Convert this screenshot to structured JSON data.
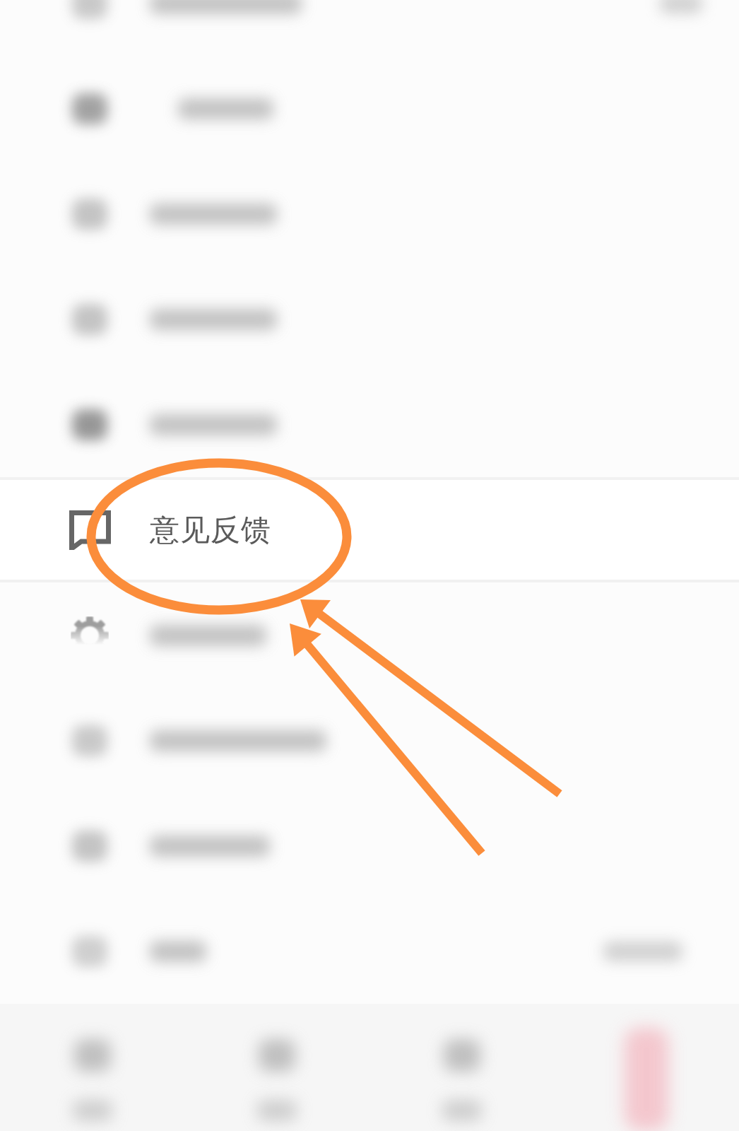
{
  "menu": {
    "items": [
      {
        "kind": "blurred",
        "trailing": true
      },
      {
        "kind": "blurred",
        "trailing": false
      },
      {
        "kind": "blurred",
        "trailing": false
      },
      {
        "kind": "blurred",
        "trailing": false
      },
      {
        "kind": "blurred",
        "trailing": false
      },
      {
        "kind": "entry",
        "label": "意见反馈"
      },
      {
        "kind": "settings",
        "trailing": false
      },
      {
        "kind": "blurred",
        "trailing": false
      },
      {
        "kind": "blurred",
        "trailing": false
      },
      {
        "kind": "blurred",
        "trailing": true
      }
    ]
  },
  "bottom_nav": {
    "items": [
      {
        "selected": false
      },
      {
        "selected": false
      },
      {
        "selected": false
      },
      {
        "selected": true
      }
    ]
  },
  "annotations": [
    {
      "kind": "ellipse"
    },
    {
      "kind": "arrow"
    },
    {
      "kind": "arrow"
    }
  ]
}
